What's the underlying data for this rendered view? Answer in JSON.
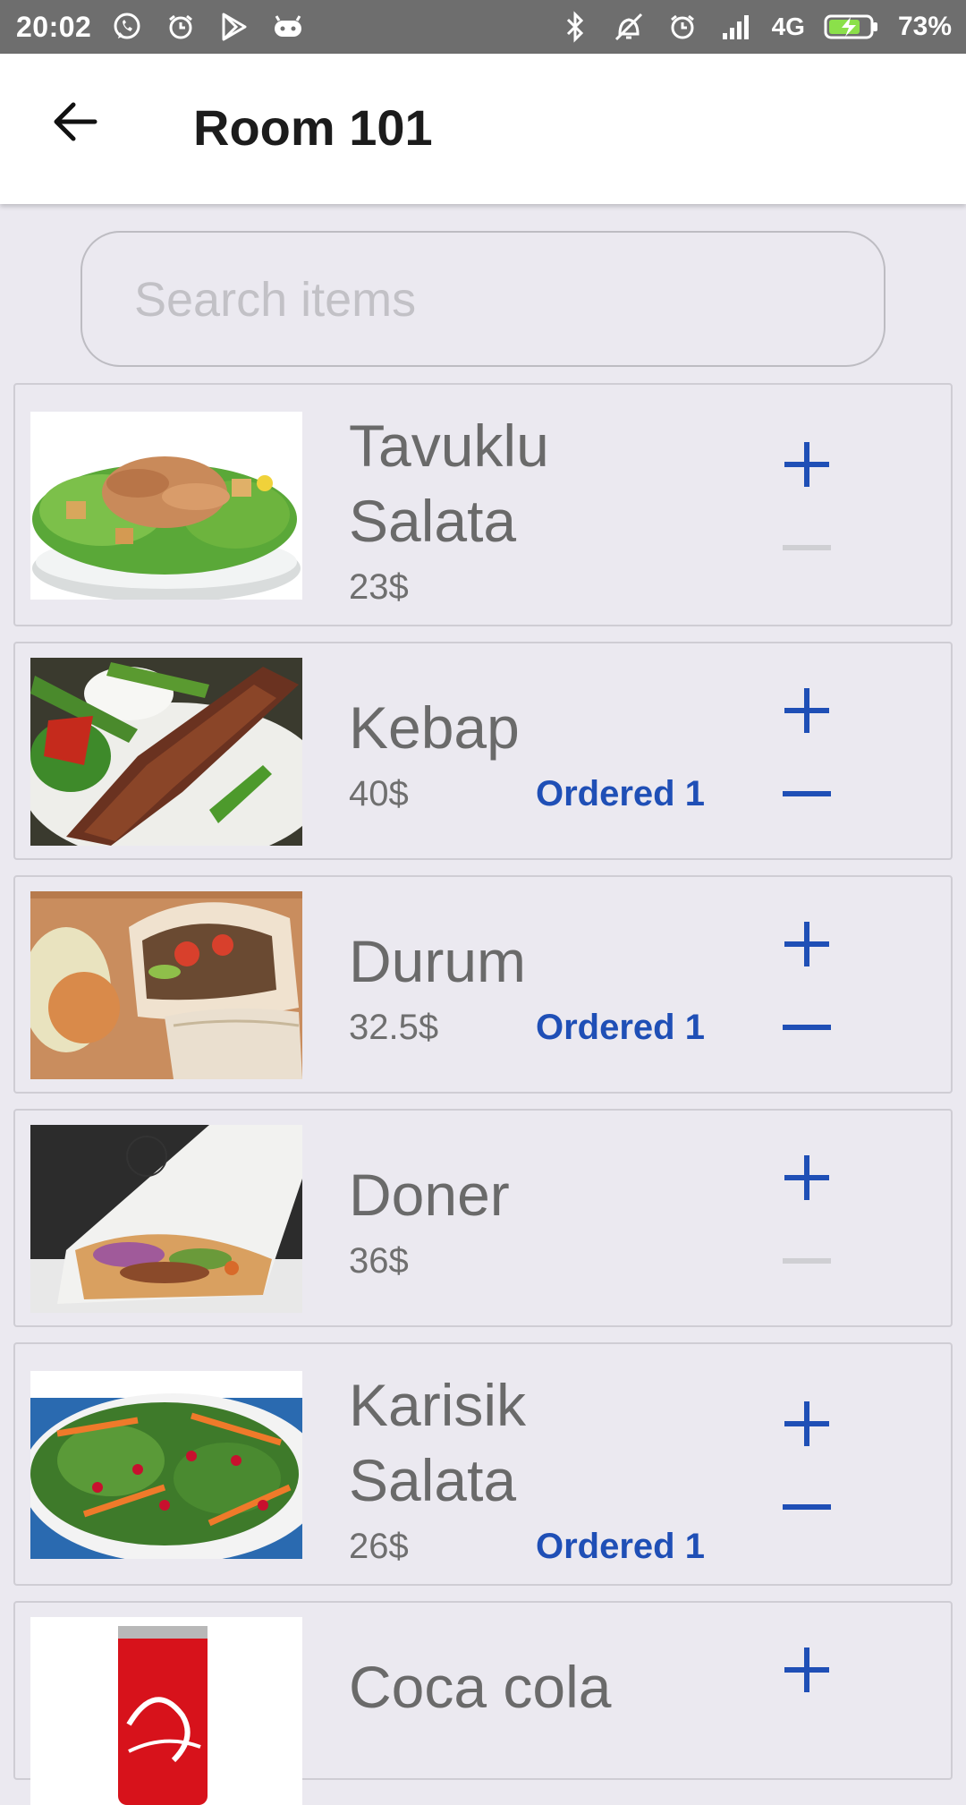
{
  "status_bar": {
    "time": "20:02",
    "network": "4G",
    "battery": "73%",
    "left_icons": [
      "whatsapp-icon",
      "alarm-icon",
      "play-store-icon",
      "android-icon"
    ],
    "right_icons": [
      "bluetooth-icon",
      "vibrate-off-icon",
      "alarm-icon",
      "signal-icon",
      "battery-charging-icon"
    ]
  },
  "header": {
    "title": "Room 101",
    "back_icon": "arrow-left-icon"
  },
  "search": {
    "placeholder": "Search items",
    "value": ""
  },
  "colors": {
    "accent": "#1f4fb6",
    "disabled": "#cfcfd3",
    "background": "#ebe9f0",
    "text_gray": "#6a6a6a"
  },
  "items": [
    {
      "name": "Tavuklu Salata",
      "name_line1": "Tavuklu",
      "name_line2": "Salata",
      "price": "23$",
      "ordered_label": "",
      "minus_enabled": false,
      "image": "chicken-salad"
    },
    {
      "name": "Kebap",
      "price": "40$",
      "ordered_label": "Ordered 1",
      "minus_enabled": true,
      "image": "kebab"
    },
    {
      "name": "Durum",
      "price": "32.5$",
      "ordered_label": "Ordered 1",
      "minus_enabled": true,
      "image": "durum-wrap"
    },
    {
      "name": "Doner",
      "price": "36$",
      "ordered_label": "",
      "minus_enabled": false,
      "image": "doner"
    },
    {
      "name": "Karisik Salata",
      "name_line1": "Karisik",
      "name_line2": "Salata",
      "price": "26$",
      "ordered_label": "Ordered 1",
      "minus_enabled": true,
      "image": "mixed-salad"
    },
    {
      "name": "Coca cola",
      "price": "",
      "ordered_label": "",
      "minus_enabled": false,
      "image": "coca-cola-can"
    }
  ]
}
